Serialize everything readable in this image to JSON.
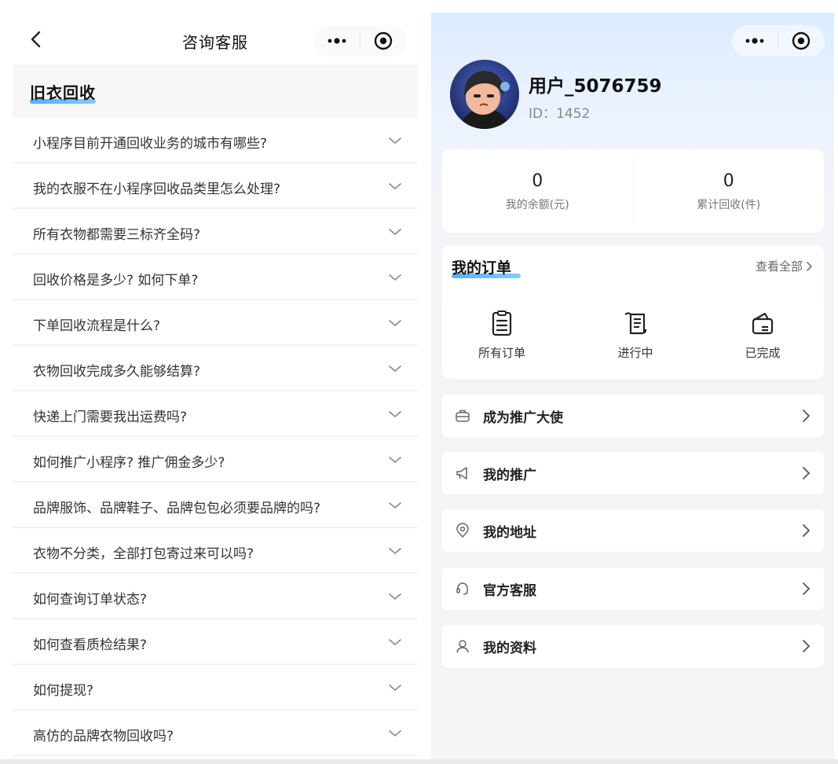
{
  "left_panel": {
    "nav": {
      "title": "咨询客服"
    },
    "capsule": {
      "more_icon": "more-dots-icon",
      "target_icon": "close-target-icon"
    },
    "section": {
      "title": "旧衣回收"
    },
    "faq": [
      "小程序目前开通回收业务的城市有哪些?",
      "我的衣服不在小程序回收品类里怎么处理?",
      "所有衣物都需要三标齐全码?",
      "回收价格是多少? 如何下单?",
      "下单回收流程是什么?",
      "衣物回收完成多久能够结算?",
      "快递上门需要我出运费吗?",
      "如何推广小程序? 推广佣金多少?",
      "品牌服饰、品牌鞋子、品牌包包必须要品牌的吗?",
      "衣物不分类，全部打包寄过来可以吗?",
      "如何查询订单状态?",
      "如何查看质检结果?",
      "如何提现?",
      "高仿的品牌衣物回收吗?"
    ]
  },
  "right_panel": {
    "user": {
      "name": "用户_5076759",
      "id": "ID：1452"
    },
    "stats": [
      {
        "value": "0",
        "label": "我的余额(元)"
      },
      {
        "value": "0",
        "label": "累计回收(件)"
      }
    ],
    "orders": {
      "title": "我的订单",
      "view_all": "查看全部",
      "entries": [
        {
          "label": "所有订单",
          "icon": "clipboard-icon"
        },
        {
          "label": "进行中",
          "icon": "scroll-icon"
        },
        {
          "label": "已完成",
          "icon": "wallet-icon"
        }
      ]
    },
    "menu": [
      {
        "label": "成为推广大使",
        "icon": "briefcase-icon"
      },
      {
        "label": "我的推广",
        "icon": "megaphone-icon"
      },
      {
        "label": "我的地址",
        "icon": "location-pin-icon"
      },
      {
        "label": "官方客服",
        "icon": "headset-icon"
      },
      {
        "label": "我的资料",
        "icon": "person-icon"
      }
    ]
  },
  "colors": {
    "accent_underline": "#3aa0ff",
    "header_gradient_top": "#dcebff",
    "page_bg": "#f3f4f6"
  }
}
